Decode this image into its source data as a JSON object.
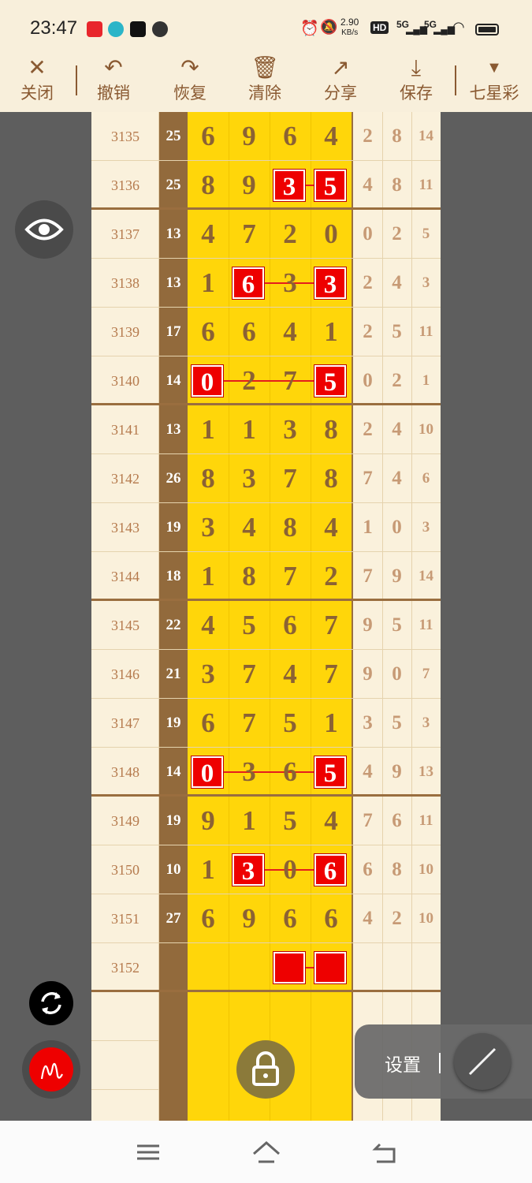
{
  "status": {
    "time": "23:47",
    "net_speed_top": "2.90",
    "net_speed_unit": "KB/s",
    "sig1": "5G",
    "sig2": "5G",
    "hd": "HD"
  },
  "toolbar": {
    "close": "关闭",
    "undo": "撤销",
    "redo": "恢复",
    "clear": "清除",
    "share": "分享",
    "save": "保存",
    "lottery": "七星彩"
  },
  "colors": {
    "accent": "#8a5a32",
    "hit": "#ee0000",
    "yellow": "#ffd60a",
    "brown": "#926a3c"
  },
  "rows": [
    {
      "issue": "3135",
      "sum": "25",
      "d": [
        "6",
        "9",
        "6",
        "4"
      ],
      "s": [
        "2",
        "8",
        "14"
      ],
      "hits": []
    },
    {
      "issue": "3136",
      "sum": "25",
      "d": [
        "8",
        "9",
        "3",
        "5"
      ],
      "s": [
        "4",
        "8",
        "11"
      ],
      "hits": [
        2,
        3
      ]
    },
    {
      "issue": "3137",
      "sum": "13",
      "d": [
        "4",
        "7",
        "2",
        "0"
      ],
      "s": [
        "0",
        "2",
        "5"
      ],
      "hits": []
    },
    {
      "issue": "3138",
      "sum": "13",
      "d": [
        "1",
        "6",
        "3",
        "3"
      ],
      "s": [
        "2",
        "4",
        "3"
      ],
      "hits": [
        1,
        3
      ]
    },
    {
      "issue": "3139",
      "sum": "17",
      "d": [
        "6",
        "6",
        "4",
        "1"
      ],
      "s": [
        "2",
        "5",
        "11"
      ],
      "hits": []
    },
    {
      "issue": "3140",
      "sum": "14",
      "d": [
        "0",
        "2",
        "7",
        "5"
      ],
      "s": [
        "0",
        "2",
        "1"
      ],
      "hits": [
        0,
        3
      ]
    },
    {
      "issue": "3141",
      "sum": "13",
      "d": [
        "1",
        "1",
        "3",
        "8"
      ],
      "s": [
        "2",
        "4",
        "10"
      ],
      "hits": []
    },
    {
      "issue": "3142",
      "sum": "26",
      "d": [
        "8",
        "3",
        "7",
        "8"
      ],
      "s": [
        "7",
        "4",
        "6"
      ],
      "hits": []
    },
    {
      "issue": "3143",
      "sum": "19",
      "d": [
        "3",
        "4",
        "8",
        "4"
      ],
      "s": [
        "1",
        "0",
        "3"
      ],
      "hits": []
    },
    {
      "issue": "3144",
      "sum": "18",
      "d": [
        "1",
        "8",
        "7",
        "2"
      ],
      "s": [
        "7",
        "9",
        "14"
      ],
      "hits": []
    },
    {
      "issue": "3145",
      "sum": "22",
      "d": [
        "4",
        "5",
        "6",
        "7"
      ],
      "s": [
        "9",
        "5",
        "11"
      ],
      "hits": []
    },
    {
      "issue": "3146",
      "sum": "21",
      "d": [
        "3",
        "7",
        "4",
        "7"
      ],
      "s": [
        "9",
        "0",
        "7"
      ],
      "hits": []
    },
    {
      "issue": "3147",
      "sum": "19",
      "d": [
        "6",
        "7",
        "5",
        "1"
      ],
      "s": [
        "3",
        "5",
        "3"
      ],
      "hits": []
    },
    {
      "issue": "3148",
      "sum": "14",
      "d": [
        "0",
        "3",
        "6",
        "5"
      ],
      "s": [
        "4",
        "9",
        "13"
      ],
      "hits": [
        0,
        3
      ]
    },
    {
      "issue": "3149",
      "sum": "19",
      "d": [
        "9",
        "1",
        "5",
        "4"
      ],
      "s": [
        "7",
        "6",
        "11"
      ],
      "hits": []
    },
    {
      "issue": "3150",
      "sum": "10",
      "d": [
        "1",
        "3",
        "0",
        "6"
      ],
      "s": [
        "6",
        "8",
        "10"
      ],
      "hits": [
        1,
        3
      ]
    },
    {
      "issue": "3151",
      "sum": "27",
      "d": [
        "6",
        "9",
        "6",
        "6"
      ],
      "s": [
        "4",
        "2",
        "10"
      ],
      "hits": []
    },
    {
      "issue": "3152",
      "sum": "",
      "d": [
        "",
        "",
        "",
        ""
      ],
      "s": [
        "",
        "",
        ""
      ],
      "hits": [
        2,
        3
      ]
    }
  ],
  "settings": {
    "label": "设置",
    "sep": "|"
  }
}
